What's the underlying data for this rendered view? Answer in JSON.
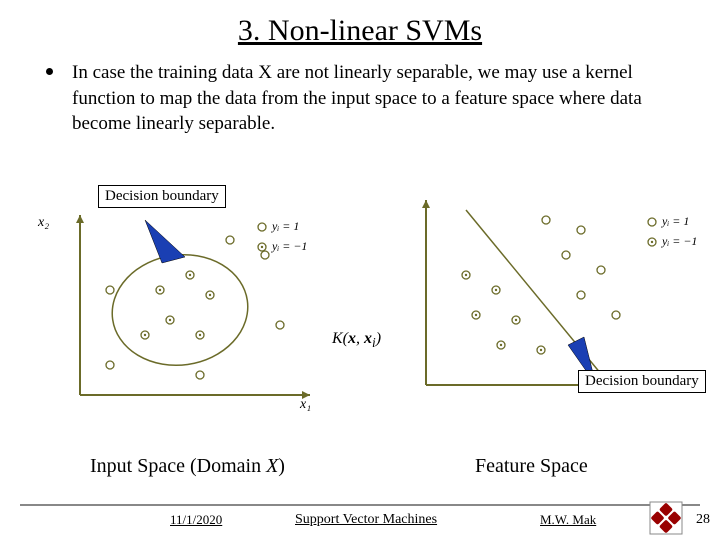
{
  "title": "3. Non-linear SVMs",
  "body": "In case the training data X are not linearly separable, we may use a kernel function to map the data from the input space to a feature space where data become linearly separable.",
  "decision_boundary_label": "Decision boundary",
  "kernel_label": "K(x, xᵢ)",
  "axis_x1": "x₁",
  "axis_x2": "x₂",
  "legend_y_pos": "yᵢ = 1",
  "legend_y_neg": "yᵢ = −1",
  "caption_left": "Input Space (Domain X)",
  "caption_right": "Feature Space",
  "footer": {
    "date": "11/1/2020",
    "center": "Support Vector Machines",
    "author": "M.W. Mak",
    "page": "28"
  },
  "colors": {
    "olive": "#6b6b29",
    "blue": "#1a3fb3"
  }
}
